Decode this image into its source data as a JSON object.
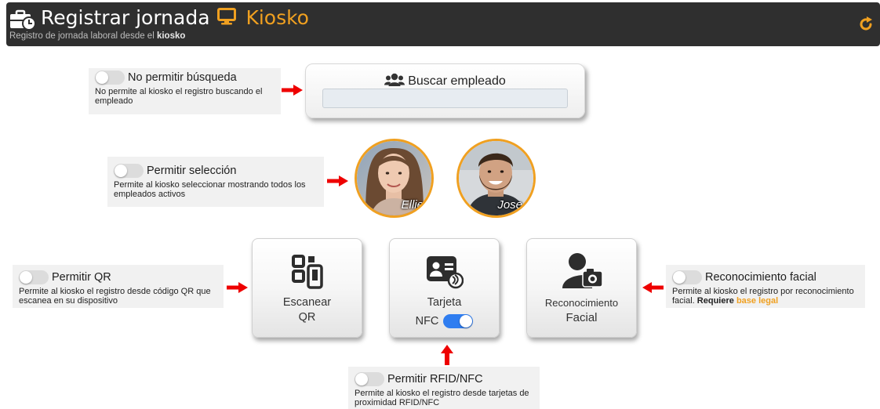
{
  "header": {
    "title": "Registrar jornada",
    "kiosk": "Kiosko",
    "subtitle_prefix": "Registro de jornada laboral desde el ",
    "subtitle_bold": "kiosko"
  },
  "search": {
    "title": "Buscar empleado",
    "placeholder": ""
  },
  "options": {
    "no_search": {
      "label": "No permitir búsqueda",
      "desc": "No permite al kiosko el registro buscando el empleado",
      "enabled": false
    },
    "selection": {
      "label": "Permitir selección",
      "desc": "Permite al kiosko seleccionar mostrando todos los empleados activos",
      "enabled": false
    },
    "qr": {
      "label": "Permitir QR",
      "desc": "Permite al kiosko el registro desde código QR que escanea en su dispositivo",
      "enabled": false
    },
    "facial": {
      "label": "Reconocimiento facial",
      "desc_prefix": "Permite al kiosko el registro por reconocimiento facial. ",
      "desc_bold": "Requiere",
      "desc_link": "base legal",
      "enabled": false
    },
    "rfid": {
      "label": "Permitir RFID/NFC",
      "desc": "Permite al kiosko el registro desde tarjetas de proximidad RFID/NFC",
      "enabled": false
    }
  },
  "employees": [
    {
      "name": "Ellie"
    },
    {
      "name": "Jose"
    }
  ],
  "methods": {
    "qr": {
      "line1": "Escanear",
      "line2": "QR"
    },
    "card": {
      "line1": "Tarjeta",
      "nfc_label": "NFC",
      "nfc_enabled": true
    },
    "facial": {
      "line1": "Reconocimiento",
      "line2": "Facial"
    }
  },
  "icons": {
    "header": "briefcase-clock-icon",
    "kiosk": "monitor-icon",
    "refresh": "refresh-icon",
    "search": "users-icon",
    "qr": "qr-phone-icon",
    "card": "id-card-nfc-icon",
    "facial": "user-camera-icon"
  },
  "colors": {
    "accent": "#f0a020",
    "header_bg": "#2f2f2f",
    "arrow": "#ee0000",
    "toggle_on": "#2f7df0"
  }
}
